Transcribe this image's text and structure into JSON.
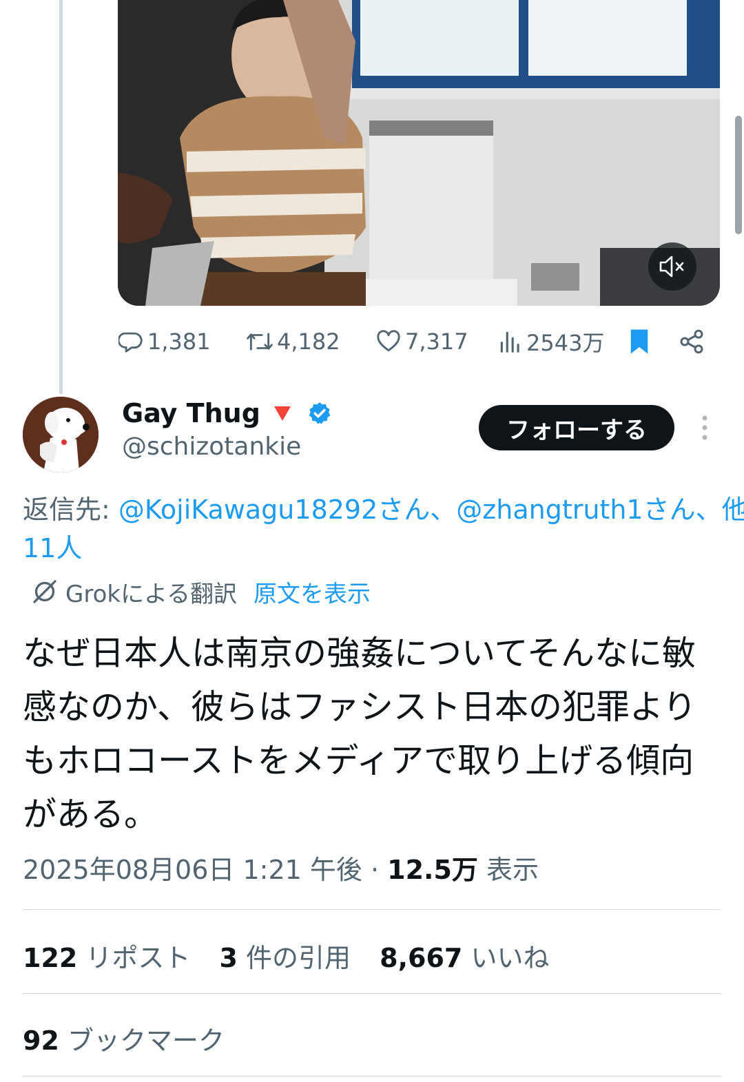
{
  "prev_tweet": {
    "actions": {
      "replies": "1,381",
      "reposts": "4,182",
      "likes": "7,317",
      "views": "2543万"
    }
  },
  "tweet": {
    "author": {
      "name": "Gay Thug",
      "flag_emoji": "🔻",
      "handle": "@schizotankie"
    },
    "follow_label": "フォローする",
    "reply_to": {
      "prefix": "返信先: ",
      "mention1": "@KojiKawagu18292",
      "suffix1": "さん、",
      "mention2": "@zhangtruth1",
      "suffix2": "さん、他",
      "others": "11人"
    },
    "translation": {
      "label": "Grokによる翻訳",
      "show_original": "原文を表示"
    },
    "text_lines": [
      "なぜ日本人は南京の強姦についてそんなに敏",
      "感なのか、彼らはファシスト日本の犯罪より",
      "もホロコーストをメディアで取り上げる傾向",
      "がある。"
    ],
    "timestamp": "2025年08月06日 1:21 午後",
    "separator": " · ",
    "views_count": "12.5万",
    "views_label": " 表示",
    "stats": {
      "reposts_count": "122",
      "reposts_label": " リポスト",
      "quotes_count": "3",
      "quotes_label": " 件の引用",
      "likes_count": "8,667",
      "likes_label": " いいね",
      "bookmarks_count": "92",
      "bookmarks_label": " ブックマーク"
    }
  },
  "colors": {
    "link": "#1d9bf0",
    "secondary_text": "#536471",
    "primary_text": "#0f1419",
    "divider": "#cfd9de",
    "verified": "#1d9bf0",
    "bookmark_active": "#1d9bf0"
  },
  "icons": [
    "reply-icon",
    "repost-icon",
    "like-icon",
    "views-icon",
    "bookmark-icon",
    "share-icon",
    "mute-icon",
    "verified-badge-icon",
    "more-icon",
    "grok-translate-icon"
  ]
}
